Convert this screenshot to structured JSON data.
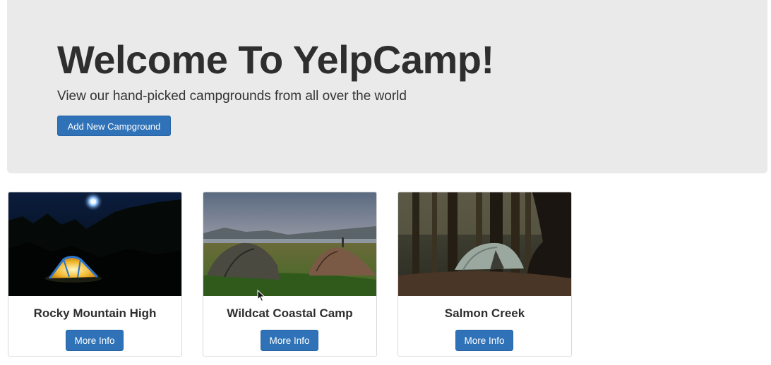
{
  "jumbotron": {
    "title": "Welcome To YelpCamp!",
    "subtitle": "View our hand-picked campgrounds from all over the world",
    "add_button_label": "Add New Campground"
  },
  "campgrounds": [
    {
      "name": "Rocky Mountain High",
      "button_label": "More Info",
      "image": "night-tent-image"
    },
    {
      "name": "Wildcat Coastal Camp",
      "button_label": "More Info",
      "image": "coastal-tents-image"
    },
    {
      "name": "Salmon Creek",
      "button_label": "More Info",
      "image": "forest-tent-image"
    }
  ],
  "colors": {
    "jumbotron_bg": "#eaeaea",
    "primary_button": "#2f72b8"
  }
}
